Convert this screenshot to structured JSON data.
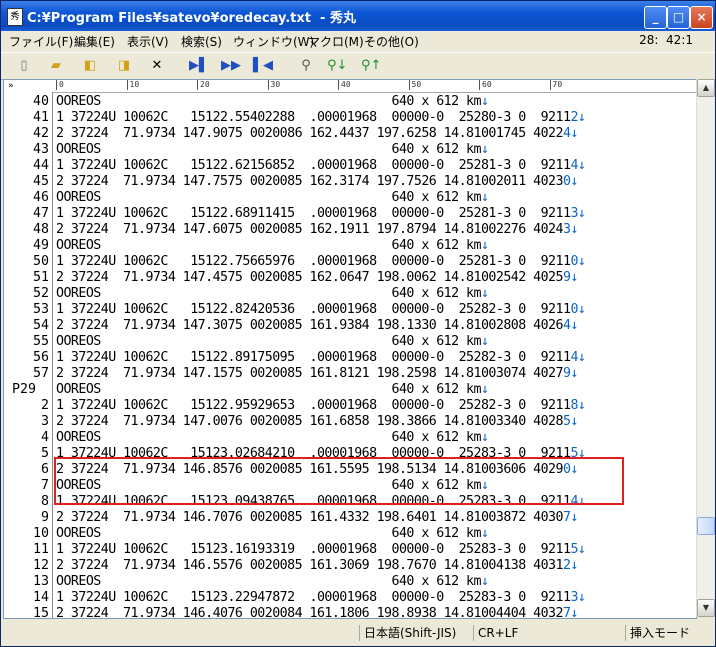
{
  "window": {
    "title": "C:¥Program Files¥satevo¥oredecay.txt  - 秀丸",
    "icon": "document-icon",
    "minimize_label": "_",
    "maximize_label": "□",
    "close_label": "×"
  },
  "menu": {
    "items": [
      "ファイル(F)",
      "編集(E)",
      "表示(V)",
      "検索(S)",
      "ウィンドウ(W)",
      "マクロ(M)",
      "その他(O)"
    ],
    "cursor_position": "28:  42:1"
  },
  "toolbar": {
    "icons": [
      "new-file-icon",
      "open-folder-icon",
      "folder-back-icon",
      "folder-forward-icon",
      "close-x-icon",
      "jump-icon",
      "jump-all-icon",
      "jump-back-icon",
      "search-icon",
      "search-down-icon",
      "search-up-icon"
    ]
  },
  "ruler": {
    "numbers": [
      "0",
      "10",
      "20",
      "30",
      "40",
      "50",
      "60",
      "70"
    ],
    "marker": "»"
  },
  "lines": [
    {
      "num": "40",
      "text": "OOREOS                                       640 x 612 km"
    },
    {
      "num": "41",
      "text": "1 37224U 10062C   15122.55402288  .00001968  00000-0  25280-3 0  9211"
    },
    {
      "num": "42",
      "text": "2 37224  71.9734 147.9075 0020086 162.4437 197.6258 14.81001745 4022"
    },
    {
      "num": "43",
      "text": "OOREOS                                       640 x 612 km"
    },
    {
      "num": "44",
      "text": "1 37224U 10062C   15122.62156852  .00001968  00000-0  25281-3 0  9211"
    },
    {
      "num": "45",
      "text": "2 37224  71.9734 147.7575 0020085 162.3174 197.7526 14.81002011 4023"
    },
    {
      "num": "46",
      "text": "OOREOS                                       640 x 612 km"
    },
    {
      "num": "47",
      "text": "1 37224U 10062C   15122.68911415  .00001968  00000-0  25281-3 0  9211"
    },
    {
      "num": "48",
      "text": "2 37224  71.9734 147.6075 0020085 162.1911 197.8794 14.81002276 4024"
    },
    {
      "num": "49",
      "text": "OOREOS                                       640 x 612 km"
    },
    {
      "num": "50",
      "text": "1 37224U 10062C   15122.75665976  .00001968  00000-0  25281-3 0  9211"
    },
    {
      "num": "51",
      "text": "2 37224  71.9734 147.4575 0020085 162.0647 198.0062 14.81002542 4025"
    },
    {
      "num": "52",
      "text": "OOREOS                                       640 x 612 km"
    },
    {
      "num": "53",
      "text": "1 37224U 10062C   15122.82420536  .00001968  00000-0  25282-3 0  9211"
    },
    {
      "num": "54",
      "text": "2 37224  71.9734 147.3075 0020085 161.9384 198.1330 14.81002808 4026"
    },
    {
      "num": "55",
      "text": "OOREOS                                       640 x 612 km"
    },
    {
      "num": "56",
      "text": "1 37224U 10062C   15122.89175095  .00001968  00000-0  25282-3 0  9211"
    },
    {
      "num": "57",
      "text": "2 37224  71.9734 147.1575 0020085 161.8121 198.2598 14.81003074 4027"
    },
    {
      "num": "P29",
      "text": "OOREOS                                       640 x 612 km"
    },
    {
      "num": "2",
      "text": "1 37224U 10062C   15122.95929653  .00001968  00000-0  25282-3 0  9211"
    },
    {
      "num": "3",
      "text": "2 37224  71.9734 147.0076 0020085 161.6858 198.3866 14.81003340 4028"
    },
    {
      "num": "4",
      "text": "OOREOS                                       640 x 612 km"
    },
    {
      "num": "5",
      "text": "1 37224U 10062C   15123.02684210  .00001968  00000-0  25283-3 0  9211"
    },
    {
      "num": "6",
      "text": "2 37224  71.9734 146.8576 0020085 161.5595 198.5134 14.81003606 4029"
    },
    {
      "num": "7",
      "text": "OOREOS                                       640 x 612 km"
    },
    {
      "num": "8",
      "text": "1 37224U 10062C   15123.09438765  .00001968  00000-0  25283-3 0  9211"
    },
    {
      "num": "9",
      "text": "2 37224  71.9734 146.7076 0020085 161.4332 198.6401 14.81003872 4030"
    },
    {
      "num": "10",
      "text": "OOREOS                                       640 x 612 km"
    },
    {
      "num": "11",
      "text": "1 37224U 10062C   15123.16193319  .00001968  00000-0  25283-3 0  9211"
    },
    {
      "num": "12",
      "text": "2 37224  71.9734 146.5576 0020085 161.3069 198.7670 14.81004138 4031"
    },
    {
      "num": "13",
      "text": "OOREOS                                       640 x 612 km"
    },
    {
      "num": "14",
      "text": "1 37224U 10062C   15123.22947872  .00001968  00000-0  25283-3 0  9211"
    },
    {
      "num": "15",
      "text": "2 37224  71.9734 146.4076 0020084 161.1806 198.8938 14.81004404 4032"
    }
  ],
  "line_suffixes": [
    "↓",
    "2↓",
    "4↓",
    "↓",
    "4↓",
    "0↓",
    "↓",
    "3↓",
    "3↓",
    "↓",
    "0↓",
    "9↓",
    "↓",
    "0↓",
    "4↓",
    "↓",
    "4↓",
    "9↓",
    "↓",
    "8↓",
    "5↓",
    "↓",
    "5↓",
    "0↓",
    "↓",
    "4↓",
    "7↓",
    "↓",
    "5↓",
    "2↓",
    "↓",
    "3↓",
    "7↓"
  ],
  "status": {
    "encoding": "日本語(Shift-JIS)",
    "line_ending": "CR+LF",
    "mode": "挿入モード"
  },
  "colors": {
    "highlight_border": "#e02020",
    "eol_marker": "#0a64c8"
  }
}
